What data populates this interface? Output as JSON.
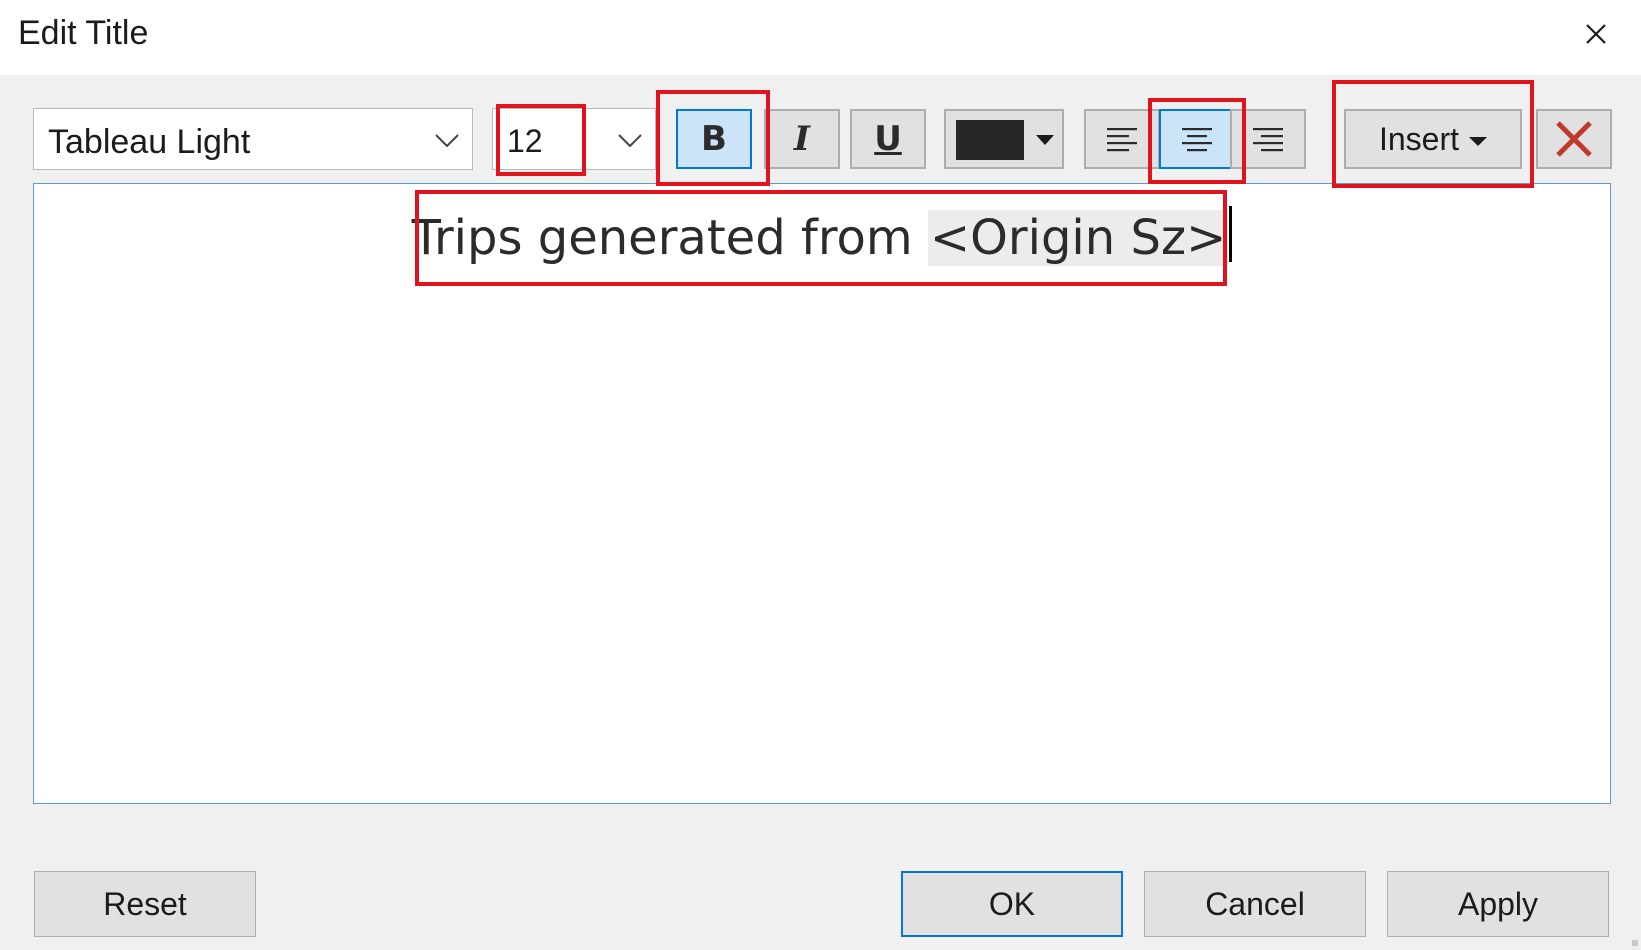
{
  "dialog": {
    "title": "Edit Title"
  },
  "toolbar": {
    "font_family": "Tableau Light",
    "font_size": "12",
    "bold_label": "B",
    "bold_active": true,
    "italic_label": "I",
    "underline_label": "U",
    "text_color": "#262626",
    "align_options": [
      "align-left",
      "align-center",
      "align-right"
    ],
    "align_selected": "align-center",
    "insert_label": "Insert",
    "clear_icon_color": "#c0392b"
  },
  "editor": {
    "text_prefix": "Trips generated from ",
    "field_token": "<Origin Sz>"
  },
  "footer": {
    "reset_label": "Reset",
    "ok_label": "OK",
    "cancel_label": "Cancel",
    "apply_label": "Apply"
  },
  "colors": {
    "highlight": "#e0141e",
    "accent": "#0078d7"
  }
}
